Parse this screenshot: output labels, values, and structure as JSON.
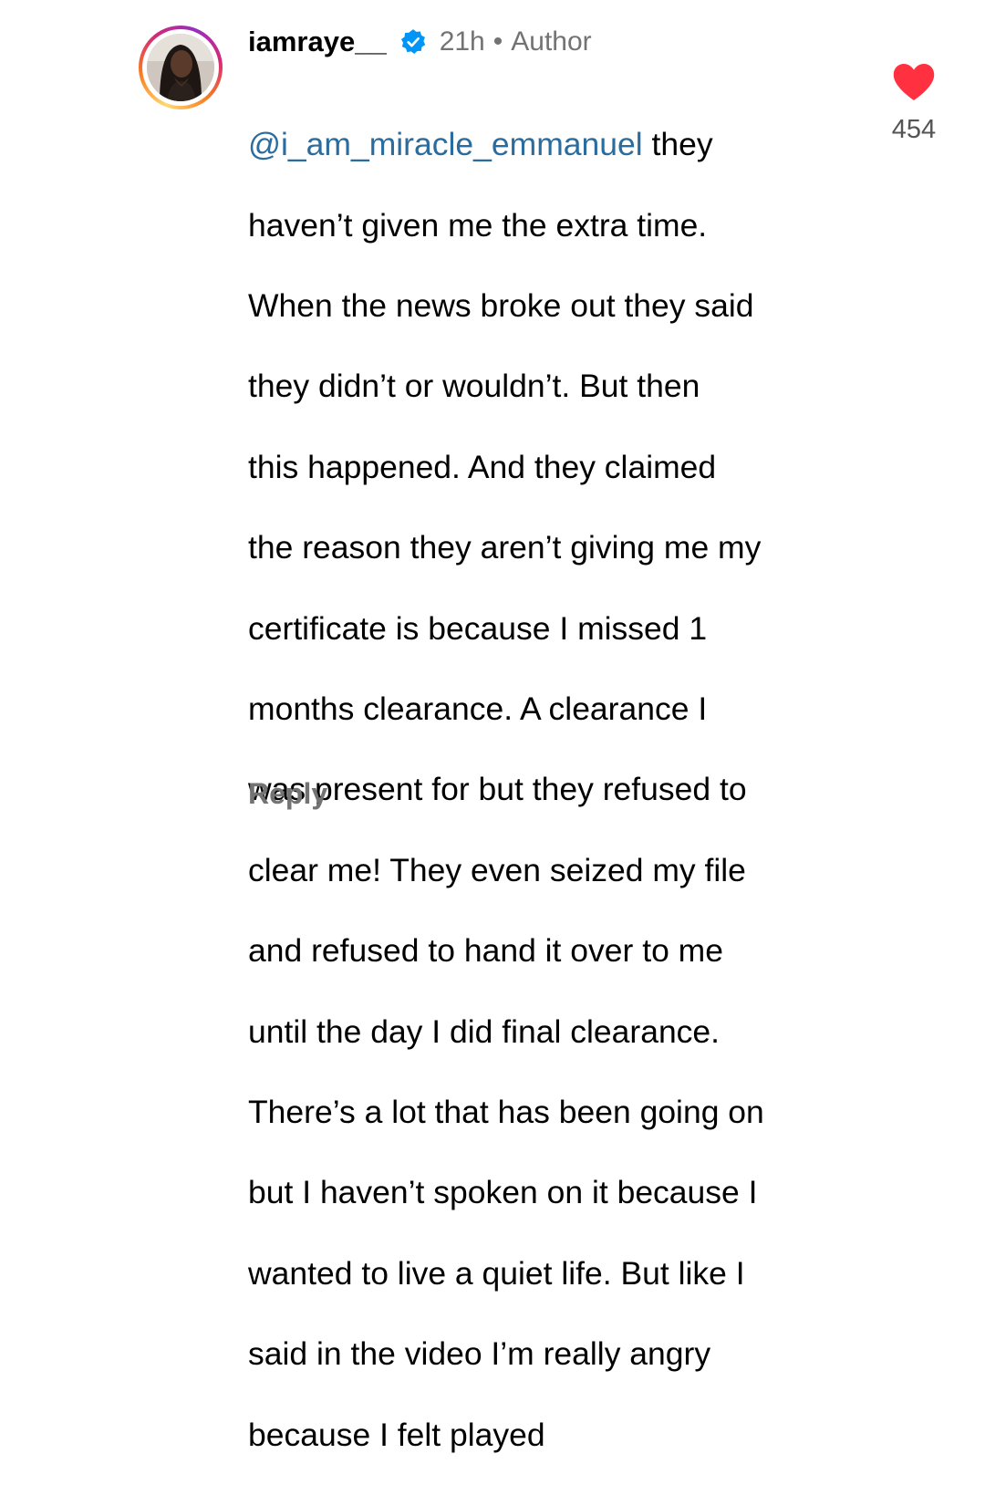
{
  "comment": {
    "username": "iamraye__",
    "verified": true,
    "time": "21h",
    "separator": "•",
    "author_badge": "Author",
    "mention": "@i_am_miracle_emmanuel",
    "first_line_rest": " they",
    "lines": [
      "haven’t given me the extra time.",
      "When the news broke out they said",
      "they didn’t or wouldn’t. But then",
      "this happened. And they claimed",
      "the reason they aren’t giving me my",
      "certificate is because I missed 1",
      "months clearance. A clearance I",
      "was present for but they refused to",
      "clear me! They even seized my file",
      "and refused to hand it over to me",
      "until the day I did final clearance.",
      "There’s a lot that has been going on",
      "but I haven’t spoken on it because I",
      "wanted to live a quiet life. But like I",
      "said in the video I’m really angry",
      "because I felt played"
    ],
    "reply_label": "Reply",
    "like_count": "454",
    "liked": true
  },
  "icons": {
    "verified": "verified-badge-icon",
    "like": "heart-icon"
  },
  "colors": {
    "mention": "#2b6c9e",
    "meta": "#737373",
    "heart": "#ff3040",
    "verified": "#0095f6"
  }
}
